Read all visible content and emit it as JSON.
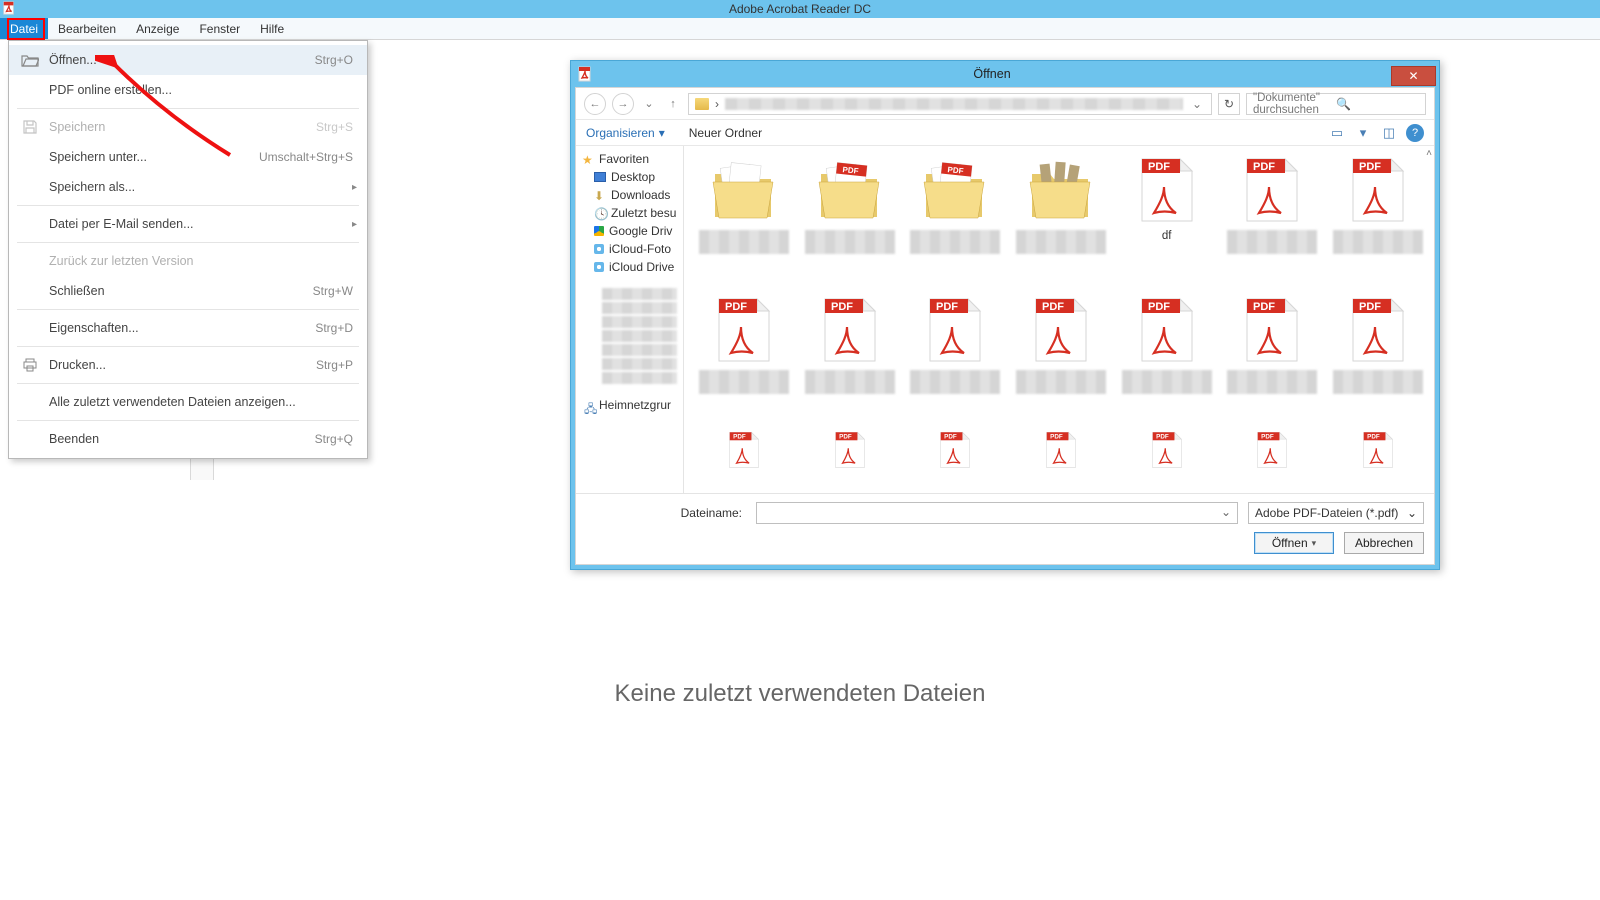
{
  "titlebar": {
    "app": "Adobe Acrobat Reader DC"
  },
  "menubar": {
    "items": [
      "Datei",
      "Bearbeiten",
      "Anzeige",
      "Fenster",
      "Hilfe"
    ],
    "active_index": 0
  },
  "dropdown": {
    "open": {
      "label": "Öffnen...",
      "shortcut": "Strg+O",
      "icon": "folder-open"
    },
    "pdf_online": {
      "label": "PDF online erstellen..."
    },
    "save": {
      "label": "Speichern",
      "shortcut": "Strg+S",
      "icon": "save",
      "disabled": true
    },
    "save_as": {
      "label": "Speichern unter...",
      "shortcut": "Umschalt+Strg+S"
    },
    "save_as2": {
      "label": "Speichern als...",
      "submenu": true
    },
    "send_mail": {
      "label": "Datei per E-Mail senden...",
      "submenu": true
    },
    "revert": {
      "label": "Zurück zur letzten Version",
      "disabled": true
    },
    "close": {
      "label": "Schließen",
      "shortcut": "Strg+W"
    },
    "properties": {
      "label": "Eigenschaften...",
      "shortcut": "Strg+D"
    },
    "print": {
      "label": "Drucken...",
      "shortcut": "Strg+P",
      "icon": "printer"
    },
    "recent": {
      "label": "Alle zuletzt verwendeten Dateien anzeigen..."
    },
    "quit": {
      "label": "Beenden",
      "shortcut": "Strg+Q"
    }
  },
  "main": {
    "no_recent": "Keine zuletzt verwendeten Dateien"
  },
  "dialog": {
    "title": "Öffnen",
    "search_placeholder": "\"Dokumente\" durchsuchen",
    "organize": "Organisieren",
    "new_folder": "Neuer Ordner",
    "tree": {
      "favorites": "Favoriten",
      "desktop": "Desktop",
      "downloads": "Downloads",
      "recent": "Zuletzt besu",
      "gdrive": "Google Driv",
      "icloud_photo": "iCloud-Foto",
      "icloud_drive": "iCloud Drive",
      "network": "Heimnetzgrur"
    },
    "files": {
      "labeled": {
        "5": "df"
      }
    },
    "filename_label": "Dateiname:",
    "filetype": "Adobe PDF-Dateien (*.pdf)",
    "open_btn": "Öffnen",
    "cancel_btn": "Abbrechen"
  }
}
